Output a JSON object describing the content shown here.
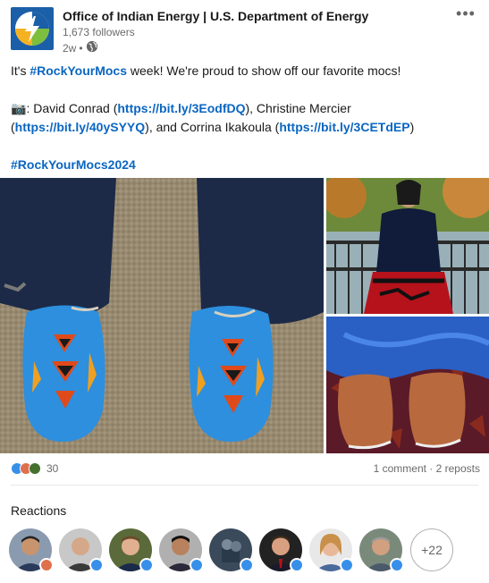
{
  "post": {
    "author": "Office of Indian Energy | U.S. Department of Energy",
    "followers": "1,673 followers",
    "time": "2w",
    "dot": "•",
    "visibility_icon": "globe-icon",
    "more_icon": "ellipsis-icon",
    "text": {
      "line1_pre": "It's ",
      "line1_tag": "#RockYourMocs",
      "line1_post": " week! We're proud to show off our favorite mocs!",
      "camera_emoji": "📷",
      "credit_1_pre": ": David Conrad (",
      "credit_1_link": "https://bit.ly/3EodfDQ",
      "credit_1_post": "), Christine Mercier",
      "credit_2_pre": "(",
      "credit_2_link": "https://bit.ly/40ySYYQ",
      "credit_2_mid": "), and Corrina Ikakoula (",
      "credit_3_link": "https://bit.ly/3CETdEP",
      "credit_3_post": ")",
      "hashtag_2024": "#RockYourMocs2024"
    }
  },
  "social": {
    "reaction_count": "30",
    "comments_reposts": "1 comment · 2 reposts",
    "reaction_types": [
      "like",
      "love",
      "celebrate"
    ]
  },
  "reactions": {
    "title": "Reactions",
    "more_count": "+22"
  },
  "colors": {
    "link_blue": "#0a66c2",
    "like_blue": "#378fe9",
    "love_red": "#df704d",
    "celebrate_green": "#44712e"
  }
}
